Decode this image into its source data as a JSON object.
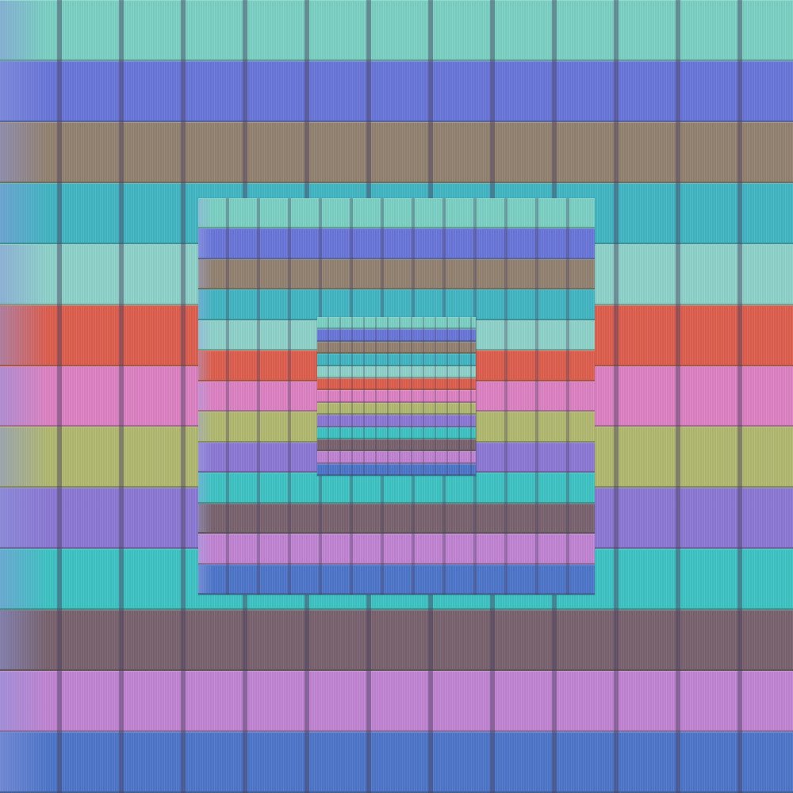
{
  "pattern": {
    "description_free": true,
    "stripe_colors": [
      "#7cd4c6",
      "#6a78dc",
      "#958472",
      "#43b8c6",
      "#90d6cd",
      "#e0604f",
      "#e084c6",
      "#b4bb72",
      "#8e7ad8",
      "#3fc6c6",
      "#7a6470",
      "#c486d6",
      "#4f78cc"
    ],
    "layers": [
      {
        "id": "outer",
        "stripe_count": 13
      },
      {
        "id": "middle",
        "stripe_count": 13
      },
      {
        "id": "inner",
        "stripe_count": 13
      }
    ]
  }
}
